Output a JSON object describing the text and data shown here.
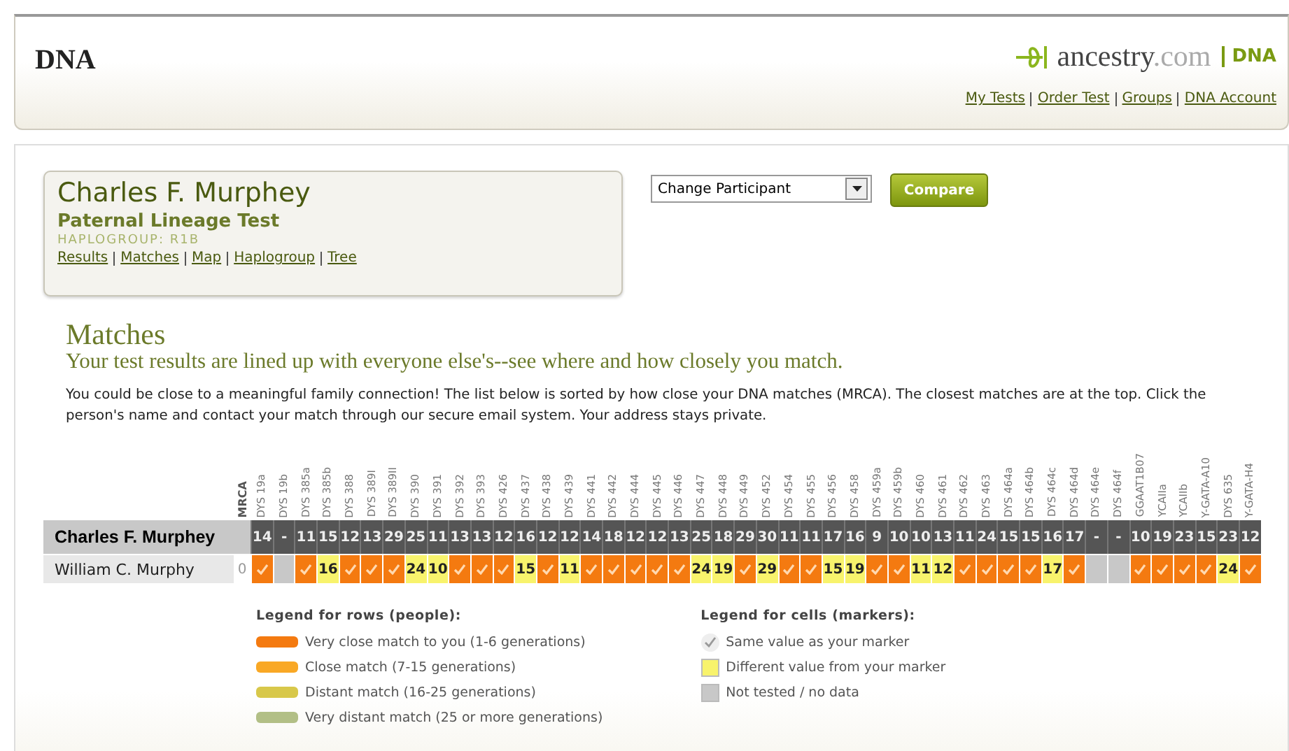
{
  "header": {
    "title": "DNA",
    "logo_text": "ancestry",
    "logo_suffix": ".com",
    "logo_product": "DNA",
    "links": [
      "My Tests",
      "Order Test",
      "Groups",
      "DNA Account"
    ]
  },
  "participant": {
    "name": "Charles F. Murphey",
    "test": "Paternal Lineage Test",
    "haplogroup": "HAPLOGROUP: R1B",
    "links": [
      "Results",
      "Matches",
      "Map",
      "Haplogroup",
      "Tree"
    ]
  },
  "participant_select": {
    "value": "Change Participant"
  },
  "compare_button": "Compare",
  "matches": {
    "title": "Matches",
    "subtitle": "Your test results are lined up with everyone else's--see where and how closely you match.",
    "description": "You could be close to a meaningful family connection! The list below is sorted by how close your DNA matches (MRCA). The closest matches are at the top. Click the person's name and contact your match through our secure email system. Your address stays private."
  },
  "table": {
    "mrca_header": "MRCA",
    "markers": [
      "DYS 19a",
      "DYS 19b",
      "DYS 385a",
      "DYS 385b",
      "DYS 388",
      "DYS 389I",
      "DYS 389II",
      "DYS 390",
      "DYS 391",
      "DYS 392",
      "DYS 393",
      "DYS 426",
      "DYS 437",
      "DYS 438",
      "DYS 439",
      "DYS 441",
      "DYS 442",
      "DYS 444",
      "DYS 445",
      "DYS 446",
      "DYS 447",
      "DYS 448",
      "DYS 449",
      "DYS 452",
      "DYS 454",
      "DYS 455",
      "DYS 456",
      "DYS 458",
      "DYS 459a",
      "DYS 459b",
      "DYS 460",
      "DYS 461",
      "DYS 462",
      "DYS 463",
      "DYS 464a",
      "DYS 464b",
      "DYS 464c",
      "DYS 464d",
      "DYS 464e",
      "DYS 464f",
      "GGAAT1B07",
      "YCAIIa",
      "YCAIIb",
      "Y-GATA-A10",
      "DYS 635",
      "Y-GATA-H4"
    ],
    "self": {
      "name": "Charles F. Murphey",
      "values": [
        "14",
        "-",
        "11",
        "15",
        "12",
        "13",
        "29",
        "25",
        "11",
        "13",
        "13",
        "12",
        "16",
        "12",
        "12",
        "14",
        "18",
        "12",
        "12",
        "13",
        "25",
        "18",
        "29",
        "30",
        "11",
        "11",
        "17",
        "16",
        "9",
        "10",
        "10",
        "13",
        "11",
        "24",
        "15",
        "15",
        "16",
        "17",
        "-",
        "-",
        "10",
        "19",
        "23",
        "15",
        "23",
        "12"
      ]
    },
    "matches": [
      {
        "name": "William C. Murphy",
        "mrca": "0",
        "color": "#f47a10",
        "cells": [
          {
            "kind": "same"
          },
          {
            "kind": "none"
          },
          {
            "kind": "same"
          },
          {
            "kind": "diff",
            "value": "16"
          },
          {
            "kind": "same"
          },
          {
            "kind": "same"
          },
          {
            "kind": "same"
          },
          {
            "kind": "diff",
            "value": "24"
          },
          {
            "kind": "diff",
            "value": "10"
          },
          {
            "kind": "same"
          },
          {
            "kind": "same"
          },
          {
            "kind": "same"
          },
          {
            "kind": "diff",
            "value": "15"
          },
          {
            "kind": "same"
          },
          {
            "kind": "diff",
            "value": "11"
          },
          {
            "kind": "same"
          },
          {
            "kind": "same"
          },
          {
            "kind": "same"
          },
          {
            "kind": "same"
          },
          {
            "kind": "same"
          },
          {
            "kind": "diff",
            "value": "24"
          },
          {
            "kind": "diff",
            "value": "19"
          },
          {
            "kind": "same"
          },
          {
            "kind": "diff",
            "value": "29"
          },
          {
            "kind": "same"
          },
          {
            "kind": "same"
          },
          {
            "kind": "diff",
            "value": "15"
          },
          {
            "kind": "diff",
            "value": "19"
          },
          {
            "kind": "same"
          },
          {
            "kind": "same"
          },
          {
            "kind": "diff",
            "value": "11"
          },
          {
            "kind": "diff",
            "value": "12"
          },
          {
            "kind": "same"
          },
          {
            "kind": "same"
          },
          {
            "kind": "same"
          },
          {
            "kind": "same"
          },
          {
            "kind": "diff",
            "value": "17"
          },
          {
            "kind": "same"
          },
          {
            "kind": "none"
          },
          {
            "kind": "none"
          },
          {
            "kind": "same"
          },
          {
            "kind": "same"
          },
          {
            "kind": "same"
          },
          {
            "kind": "same"
          },
          {
            "kind": "diff",
            "value": "24"
          },
          {
            "kind": "same"
          }
        ]
      }
    ]
  },
  "legend_rows": {
    "title": "Legend for rows (people):",
    "items": [
      {
        "label": "Very close match to you (1-6 generations)",
        "color": "#f47a10"
      },
      {
        "label": "Close match (7-15 generations)",
        "color": "#f9a825"
      },
      {
        "label": "Distant match (16-25 generations)",
        "color": "#d8c84a"
      },
      {
        "label": "Very distant match (25 or more generations)",
        "color": "#b2bf86"
      }
    ]
  },
  "legend_cells": {
    "title": "Legend for cells (markers):",
    "items": [
      {
        "label": "Same value as your marker",
        "kind": "same"
      },
      {
        "label": "Different value from your marker",
        "kind": "diff"
      },
      {
        "label": "Not tested / no data",
        "kind": "none"
      }
    ]
  }
}
